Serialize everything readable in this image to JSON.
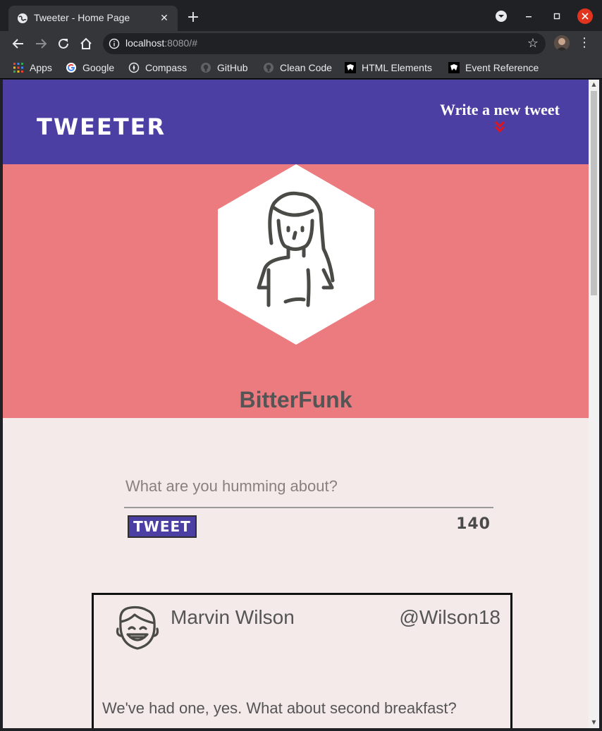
{
  "browser": {
    "tab_title": "Tweeter - Home Page",
    "tab_close": "✕",
    "new_tab": "+",
    "url_host": "localhost",
    "url_rest": ":8080/#",
    "bookmarks": [
      {
        "label": "Apps",
        "icon": "apps-grid-icon"
      },
      {
        "label": "Google",
        "icon": "google-icon"
      },
      {
        "label": "Compass",
        "icon": "compass-icon"
      },
      {
        "label": "GitHub",
        "icon": "github-icon"
      },
      {
        "label": "Clean Code",
        "icon": "github-icon"
      },
      {
        "label": "HTML Elements",
        "icon": "mdn-icon"
      },
      {
        "label": "Event Reference",
        "icon": "mdn-icon"
      }
    ]
  },
  "site": {
    "brand": "TWEETER",
    "compose_toggle": "Write a new tweet",
    "colors": {
      "nav": "#4c3fa3",
      "profile": "#ec7b80",
      "page": "#f4eaea",
      "arrow": "#e0141e"
    }
  },
  "profile": {
    "username": "BitterFunk",
    "avatar_icon": "woman-avatar-icon"
  },
  "compose": {
    "placeholder": "What are you humming about?",
    "submit_label": "TWEET",
    "counter": "140"
  },
  "tweets": [
    {
      "name": "Marvin Wilson",
      "handle": "@Wilson18",
      "text": "We've had one, yes. What about second breakfast?",
      "avatar_icon": "man-avatar-icon"
    }
  ]
}
